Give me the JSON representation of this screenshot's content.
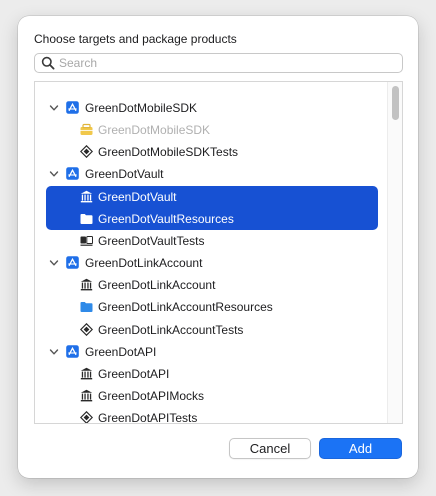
{
  "dialog": {
    "title": "Choose targets and package products",
    "search": {
      "placeholder": "Search",
      "value": ""
    },
    "buttons": {
      "cancel": "Cancel",
      "add": "Add"
    },
    "colors": {
      "selection": "#1751d3",
      "primary_button": "#1b73f5",
      "project_icon": "#1f6fe8"
    }
  },
  "tree": [
    {
      "label": "GreenDotMobileSDK",
      "level": "group",
      "icon": "project-icon",
      "expanded": true,
      "selected": false,
      "disabled": false
    },
    {
      "label": "GreenDotMobileSDK",
      "level": "child",
      "icon": "bundle-icon",
      "selected": false,
      "disabled": true
    },
    {
      "label": "GreenDotMobileSDKTests",
      "level": "child",
      "icon": "test-icon",
      "selected": false,
      "disabled": false
    },
    {
      "label": "GreenDotVault",
      "level": "group",
      "icon": "project-icon",
      "expanded": true,
      "selected": false,
      "disabled": false
    },
    {
      "label": "GreenDotVault",
      "level": "child",
      "icon": "library-icon",
      "selected": true,
      "disabled": false
    },
    {
      "label": "GreenDotVaultResources",
      "level": "child",
      "icon": "folder-icon",
      "selected": true,
      "disabled": false
    },
    {
      "label": "GreenDotVaultTests",
      "level": "child",
      "icon": "app-icon",
      "selected": false,
      "disabled": false
    },
    {
      "label": "GreenDotLinkAccount",
      "level": "group",
      "icon": "project-icon",
      "expanded": true,
      "selected": false,
      "disabled": false
    },
    {
      "label": "GreenDotLinkAccount",
      "level": "child",
      "icon": "library-icon",
      "selected": false,
      "disabled": false
    },
    {
      "label": "GreenDotLinkAccountResources",
      "level": "child",
      "icon": "folder-icon",
      "selected": false,
      "disabled": false
    },
    {
      "label": "GreenDotLinkAccountTests",
      "level": "child",
      "icon": "test-icon",
      "selected": false,
      "disabled": false
    },
    {
      "label": "GreenDotAPI",
      "level": "group",
      "icon": "project-icon",
      "expanded": true,
      "selected": false,
      "disabled": false
    },
    {
      "label": "GreenDotAPI",
      "level": "child",
      "icon": "library-icon",
      "selected": false,
      "disabled": false
    },
    {
      "label": "GreenDotAPIMocks",
      "level": "child",
      "icon": "library-icon",
      "selected": false,
      "disabled": false
    },
    {
      "label": "GreenDotAPITests",
      "level": "child",
      "icon": "test-icon",
      "selected": false,
      "disabled": false
    }
  ]
}
